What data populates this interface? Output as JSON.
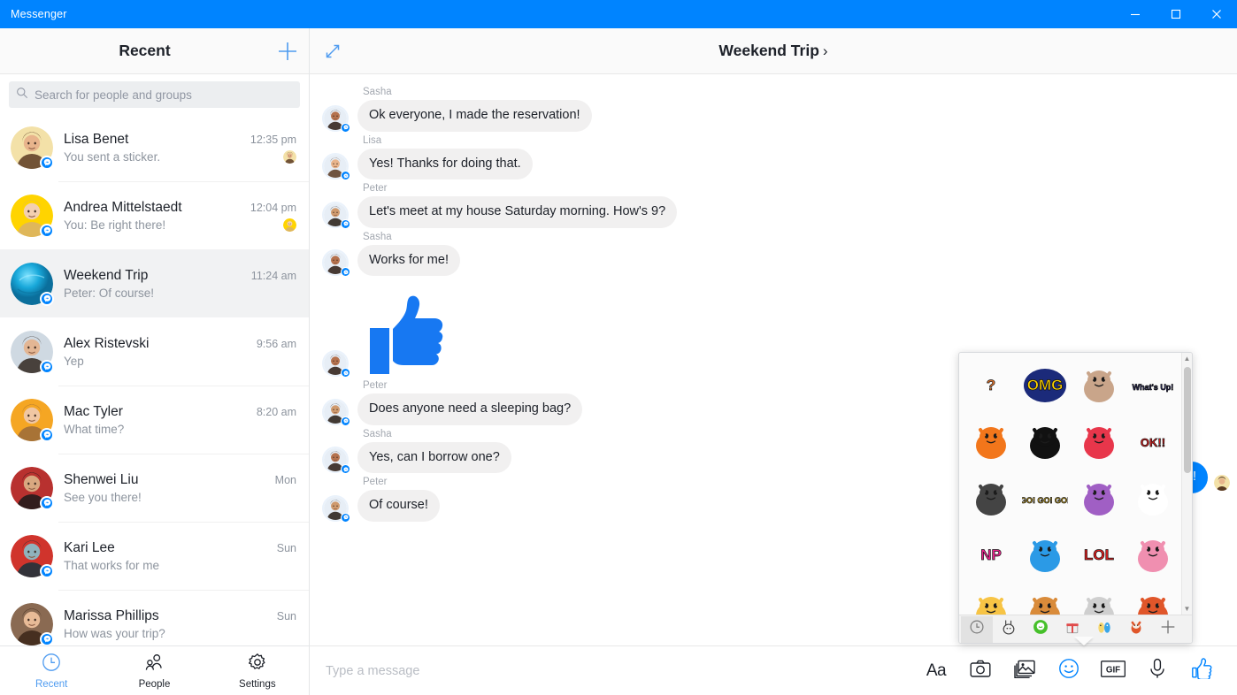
{
  "window": {
    "title": "Messenger",
    "accent": "#0084ff",
    "controls": [
      {
        "name": "minimize",
        "glyph": "minimize-icon"
      },
      {
        "name": "maximize",
        "glyph": "maximize-icon"
      },
      {
        "name": "close",
        "glyph": "close-icon"
      }
    ]
  },
  "sidebar": {
    "header_title": "Recent",
    "new_message_label": "new-message-icon",
    "search": {
      "placeholder": "Search for people and groups",
      "value": ""
    },
    "conversations": [
      {
        "name": "Lisa Benet",
        "time": "12:35 pm",
        "snippet": "You sent a sticker.",
        "selected": false,
        "receipt": true,
        "ring": "#f3e1a8",
        "skin": "#e8b48c",
        "hair": "#5a3a22"
      },
      {
        "name": "Andrea Mittelstaedt",
        "time": "12:04 pm",
        "snippet": "You: Be right there!",
        "selected": false,
        "receipt": true,
        "ring": "#ffd400",
        "skin": "#f3cfb0",
        "hair": "#d9b26a"
      },
      {
        "name": "Weekend Trip",
        "time": "11:24 am",
        "snippet": "Peter: Of course!",
        "selected": true,
        "receipt": false,
        "ring": "#16a9d8",
        "skin": "#16a9d8",
        "hair": "#0d7ba3",
        "group": true
      },
      {
        "name": "Alex Ristevski",
        "time": "9:56 am",
        "snippet": "Yep",
        "selected": false,
        "receipt": false,
        "ring": "#cfd9e2",
        "skin": "#e3b694",
        "hair": "#30261f"
      },
      {
        "name": "Mac Tyler",
        "time": "8:20 am",
        "snippet": "What time?",
        "selected": false,
        "receipt": false,
        "ring": "#f5a623",
        "skin": "#f0c7a3",
        "hair": "#9a6a3a"
      },
      {
        "name": "Shenwei Liu",
        "time": "Mon",
        "snippet": "See you there!",
        "selected": false,
        "receipt": false,
        "ring": "#b8312f",
        "skin": "#d9a880",
        "hair": "#1a1a1a"
      },
      {
        "name": "Kari Lee",
        "time": "Sun",
        "snippet": "That works for me",
        "selected": false,
        "receipt": false,
        "ring": "#d0342c",
        "skin": "#8fb3bd",
        "hair": "#16323c"
      },
      {
        "name": "Marissa Phillips",
        "time": "Sun",
        "snippet": "How was your trip?",
        "selected": false,
        "receipt": false,
        "ring": "#8a6a52",
        "skin": "#e8bb97",
        "hair": "#3a2418"
      }
    ],
    "nav": [
      {
        "label": "Recent",
        "icon": "clock-icon",
        "active": true
      },
      {
        "label": "People",
        "icon": "people-icon",
        "active": false
      },
      {
        "label": "Settings",
        "icon": "gear-icon",
        "active": false
      }
    ]
  },
  "chat": {
    "expand_icon": "expand-icon",
    "title": "Weekend Trip",
    "chevron": "›",
    "messages": [
      {
        "sender": "Sasha",
        "text": "Ok everyone, I made the reservation!",
        "side": "in",
        "type": "text",
        "skin": "#b5724e",
        "hair": "#2a1a12"
      },
      {
        "sender": "Lisa",
        "text": "Yes! Thanks for doing that.",
        "side": "in",
        "type": "text",
        "skin": "#e8b48c",
        "hair": "#5a3a22"
      },
      {
        "sender": "Peter",
        "text": "Let's meet at my house Saturday morning. How's 9?",
        "side": "in",
        "type": "text",
        "skin": "#cf9a6e",
        "hair": "#241a12"
      },
      {
        "sender": "Sasha",
        "text": "Works for me!",
        "side": "in",
        "type": "text",
        "skin": "#b5724e",
        "hair": "#2a1a12"
      },
      {
        "sender": "",
        "text": "",
        "side": "in",
        "type": "sticker",
        "sticker": "thumbs-up-sticker",
        "skin": "#b5724e",
        "hair": "#2a1a12"
      },
      {
        "sender": "Peter",
        "text": "Does anyone need a sleeping bag?",
        "side": "in",
        "type": "text",
        "skin": "#cf9a6e",
        "hair": "#241a12"
      },
      {
        "sender": "Sasha",
        "text": "Yes, can I borrow one?",
        "side": "in",
        "type": "text",
        "skin": "#b5724e",
        "hair": "#2a1a12"
      },
      {
        "sender": "Peter",
        "text": "Of course!",
        "side": "in",
        "type": "text",
        "skin": "#cf9a6e",
        "hair": "#241a12"
      }
    ],
    "outgoing_partial": {
      "text": "o!",
      "color": "#0084ff"
    }
  },
  "composer": {
    "placeholder": "Type a message",
    "value": "",
    "tools": [
      {
        "name": "text-format-button",
        "label": "Aa",
        "icon": "aa-icon",
        "active": false
      },
      {
        "name": "camera-button",
        "label": "Camera",
        "icon": "camera-icon",
        "active": false
      },
      {
        "name": "photo-button",
        "label": "Photos",
        "icon": "photo-icon",
        "active": false
      },
      {
        "name": "sticker-button",
        "label": "Stickers",
        "icon": "smiley-icon",
        "active": true
      },
      {
        "name": "gif-button",
        "label": "GIF",
        "icon": "gif-icon",
        "active": false
      },
      {
        "name": "voice-button",
        "label": "Voice clip",
        "icon": "microphone-icon",
        "active": false
      },
      {
        "name": "like-button",
        "label": "Like",
        "icon": "thumbs-up-icon",
        "active": true
      }
    ]
  },
  "sticker_picker": {
    "open": true,
    "stickers": [
      {
        "id": "fox-question",
        "caption": "?",
        "bg": "#ffffff",
        "fg": "#e8762c"
      },
      {
        "id": "omg-text",
        "caption": "OMG",
        "bg": "#1b2a7a",
        "fg": "#ffd400"
      },
      {
        "id": "dog-cat-fight",
        "caption": "",
        "bg": "#ffffff",
        "fg": "#c9a58a"
      },
      {
        "id": "whats-up-girl",
        "caption": "What's Up!",
        "bg": "#ffffff",
        "fg": "#2b2b6e"
      },
      {
        "id": "clown-fish",
        "caption": "",
        "bg": "#ffffff",
        "fg": "#f2761b"
      },
      {
        "id": "black-blob",
        "caption": "",
        "bg": "#ffffff",
        "fg": "#111111"
      },
      {
        "id": "heart-hug-pig",
        "caption": "",
        "bg": "#ffffff",
        "fg": "#e8364b"
      },
      {
        "id": "ok-egg",
        "caption": "OK!!",
        "bg": "#ffffff",
        "fg": "#e02020"
      },
      {
        "id": "white-rabbit",
        "caption": "",
        "bg": "#ffffff",
        "fg": "#444444"
      },
      {
        "id": "go-go-go-sheep",
        "caption": "GO! GO! GO!",
        "bg": "#ffffff",
        "fg": "#f5c518"
      },
      {
        "id": "lumpy-purple",
        "caption": "",
        "bg": "#ffffff",
        "fg": "#a05fc4"
      },
      {
        "id": "music-purple",
        "caption": "",
        "bg": "#8e3fc4",
        "fg": "#ffffff"
      },
      {
        "id": "np-text",
        "caption": "NP",
        "bg": "#ffffff",
        "fg": "#e8228c"
      },
      {
        "id": "blue-bear",
        "caption": "",
        "bg": "#ffffff",
        "fg": "#2b9ae6"
      },
      {
        "id": "lol-text",
        "caption": "LOL",
        "bg": "#ffffff",
        "fg": "#e02020"
      },
      {
        "id": "black-card-pig",
        "caption": "",
        "bg": "#ffffff",
        "fg": "#f08fb0"
      },
      {
        "id": "laugh-emoji",
        "caption": "",
        "bg": "#ffffff",
        "fg": "#f7c445"
      },
      {
        "id": "burger",
        "caption": "",
        "bg": "#ffffff",
        "fg": "#d98b3a"
      },
      {
        "id": "grey-shell",
        "caption": "",
        "bg": "#ffffff",
        "fg": "#cfcfcf"
      },
      {
        "id": "red-panda",
        "caption": "",
        "bg": "#ffffff",
        "fg": "#e0562a"
      }
    ],
    "tabs": [
      {
        "id": "recent-stickers-tab",
        "icon": "clock-icon",
        "active": true
      },
      {
        "id": "rabbit-pack-tab",
        "icon": "rabbit-icon",
        "active": false
      },
      {
        "id": "green-pack-tab",
        "icon": "green-blob-icon",
        "active": false
      },
      {
        "id": "gift-pack-tab",
        "icon": "gift-icon",
        "active": false
      },
      {
        "id": "adventure-pack-tab",
        "icon": "adventure-icon",
        "active": false
      },
      {
        "id": "redpanda-pack-tab",
        "icon": "red-panda-icon",
        "active": false
      },
      {
        "id": "add-pack-tab",
        "icon": "plus-icon",
        "active": false
      }
    ]
  }
}
